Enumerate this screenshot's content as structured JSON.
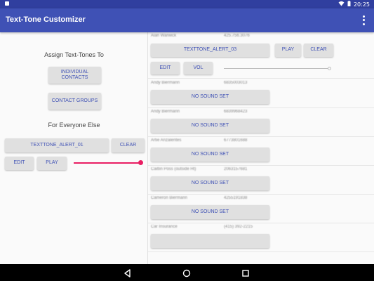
{
  "status_bar": {
    "time": "20:25",
    "notification_icon": "android-notification-icon",
    "wifi_icon": "wifi-icon",
    "battery_icon": "battery-icon"
  },
  "app_bar": {
    "title": "Text-Tone Customizer",
    "menu_icon": "overflow-menu-icon"
  },
  "left": {
    "assign_heading": "Assign Text-Tones To",
    "individual_contacts_label": "INDIVIDUAL CONTACTS",
    "contact_groups_label": "CONTACT GROUPS",
    "everyone_heading": "For Everyone Else",
    "tone_label": "TEXTTONE_ALERT_01",
    "clear_label": "CLEAR",
    "edit_label": "EDIT",
    "play_label": "PLAY",
    "volume_level": 1.0
  },
  "contacts": [
    {
      "name": "Alan Warwick",
      "number": "425.756.3076",
      "tone": "TEXTTONE_ALERT_03",
      "play_label": "PLAY",
      "clear_label": "CLEAR",
      "edit_label": "EDIT",
      "vol_label": "VOL",
      "expanded": true
    },
    {
      "name": "Andy Biermann",
      "number": "6835003013",
      "tone": "NO SOUND SET"
    },
    {
      "name": "Andy Biermann",
      "number": "6839968423",
      "tone": "NO SOUND SET"
    },
    {
      "name": "Artie Anzalentes",
      "number": "6773801688",
      "tone": "NO SOUND SET"
    },
    {
      "name": "Caitlin Poss (outside Ht)",
      "number": "2063157681",
      "tone": "NO SOUND SET"
    },
    {
      "name": "Cameron Biermann",
      "number": "4255191838",
      "tone": "NO SOUND SET"
    },
    {
      "name": "Car Insurance",
      "number": "(415) 392-2215",
      "tone": ""
    }
  ],
  "nav": {
    "back_icon": "back-triangle-icon",
    "home_icon": "home-circle-icon",
    "recents_icon": "recents-square-icon"
  },
  "colors": {
    "primary": "#3f51b5",
    "primary_dark": "#303f9f",
    "accent": "#e91e63",
    "button_bg": "#e0e0e0"
  }
}
